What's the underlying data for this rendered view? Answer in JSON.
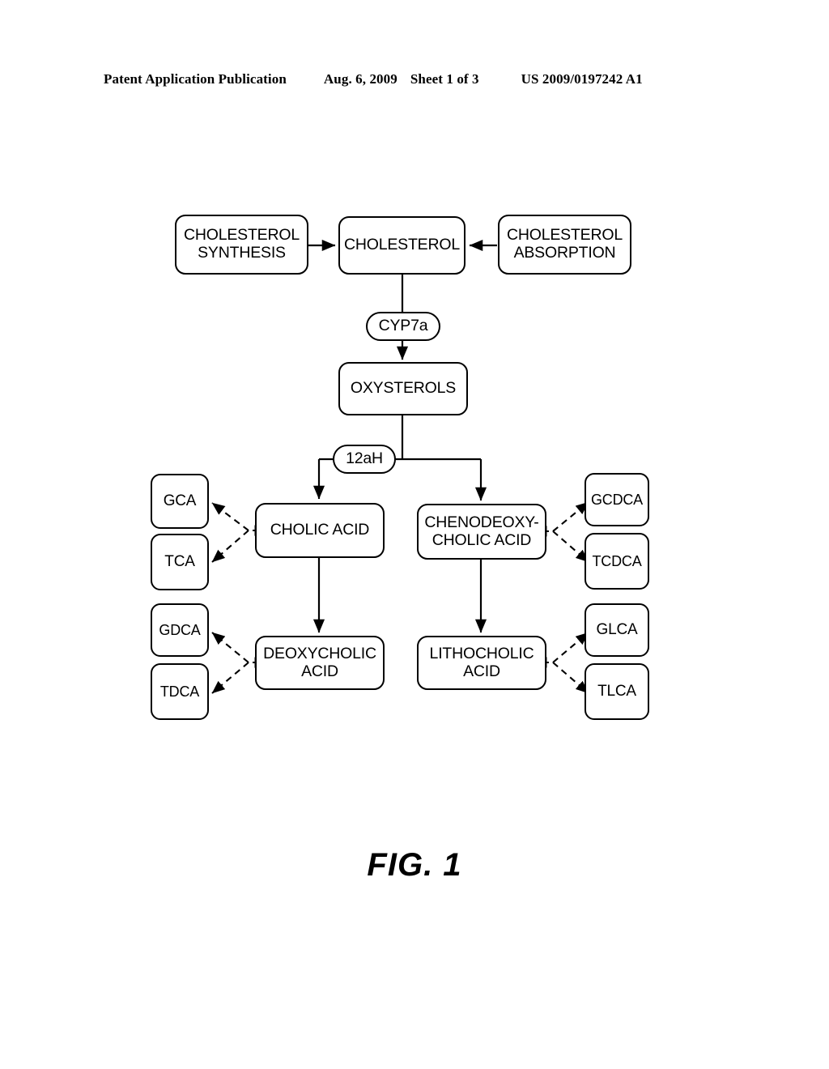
{
  "header": {
    "publication": "Patent Application Publication",
    "date": "Aug. 6, 2009",
    "sheet": "Sheet 1 of 3",
    "patent_number": "US 2009/0197242 A1"
  },
  "figure": {
    "caption": "FIG. 1",
    "nodes": {
      "cholesterol_synthesis": "CHOLESTEROL\nSYNTHESIS",
      "cholesterol": "CHOLESTEROL",
      "cholesterol_absorption": "CHOLESTEROL\nABSORPTION",
      "cyp7a": "CYP7a",
      "oxysterols": "OXYSTEROLS",
      "twelve_ah": "12aH",
      "cholic_acid": "CHOLIC ACID",
      "chenodeoxycholic_acid": "CHENODEOXY-\nCHOLIC ACID",
      "deoxycholic_acid": "DEOXYCHOLIC\nACID",
      "lithocholic_acid": "LITHOCHOLIC\nACID",
      "gca": "GCA",
      "tca": "TCA",
      "gdca": "GDCA",
      "tdca": "TDCA",
      "gcdca": "GCDCA",
      "tcdca": "TCDCA",
      "glca": "GLCA",
      "tlca": "TLCA"
    },
    "colors": {
      "stroke": "#000000",
      "fill": "#ffffff"
    }
  }
}
